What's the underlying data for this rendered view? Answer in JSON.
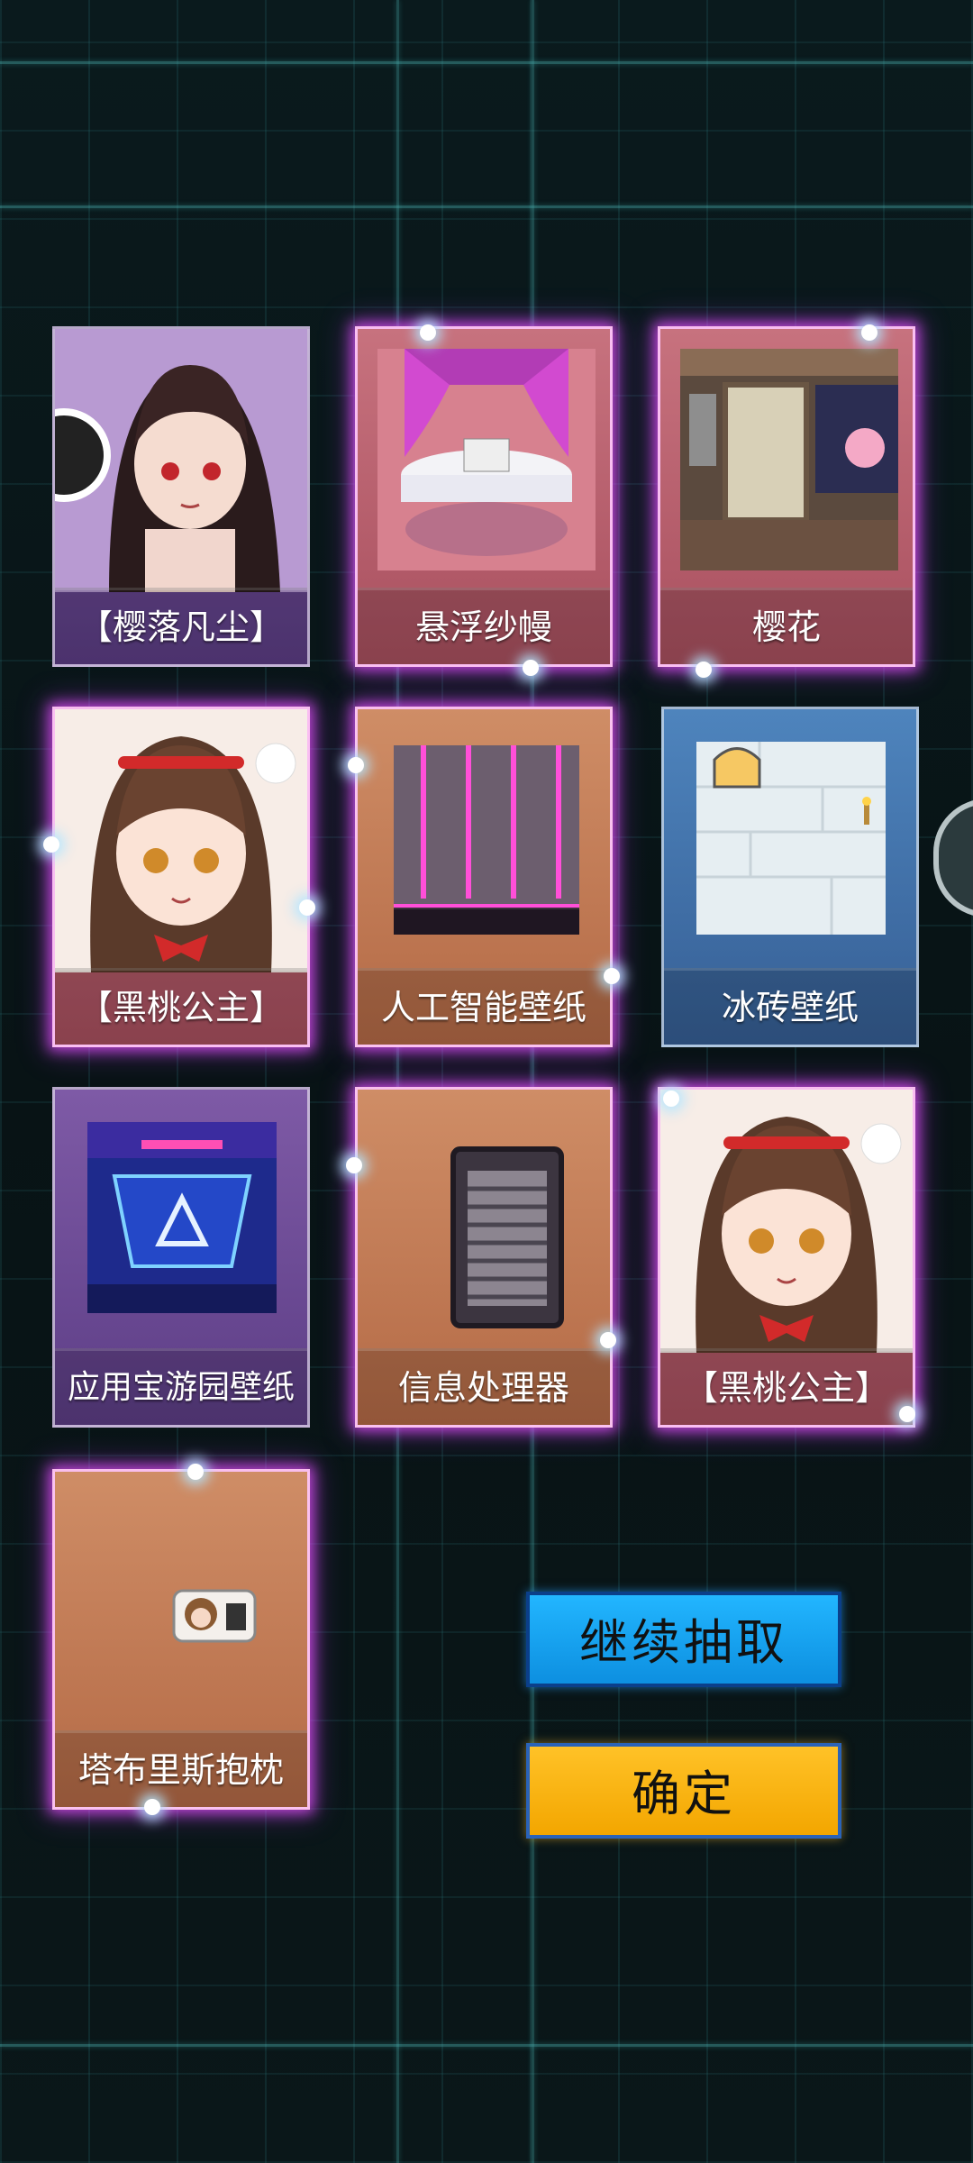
{
  "items": [
    {
      "label": "【樱落凡尘】",
      "art": "girl-portrait-icon"
    },
    {
      "label": "悬浮纱幔",
      "art": "canopy-bed-icon"
    },
    {
      "label": "樱花",
      "art": "japanese-room-icon"
    },
    {
      "label": "【黑桃公主】",
      "art": "girl-portrait-icon"
    },
    {
      "label": "人工智能壁纸",
      "art": "neon-wall-icon"
    },
    {
      "label": "冰砖壁纸",
      "art": "ice-brick-wall-icon"
    },
    {
      "label": "应用宝游园壁纸",
      "art": "game-arena-icon"
    },
    {
      "label": "信息处理器",
      "art": "server-rack-icon"
    },
    {
      "label": "【黑桃公主】",
      "art": "girl-portrait-icon"
    },
    {
      "label": "塔布里斯抱枕",
      "art": "body-pillow-icon"
    }
  ],
  "buttons": {
    "continue_label": "继续抽取",
    "confirm_label": "确定"
  },
  "colors": {
    "continue_button": "#1aa9f5",
    "confirm_button": "#f9b414",
    "rare_glow": "#e050ff"
  }
}
